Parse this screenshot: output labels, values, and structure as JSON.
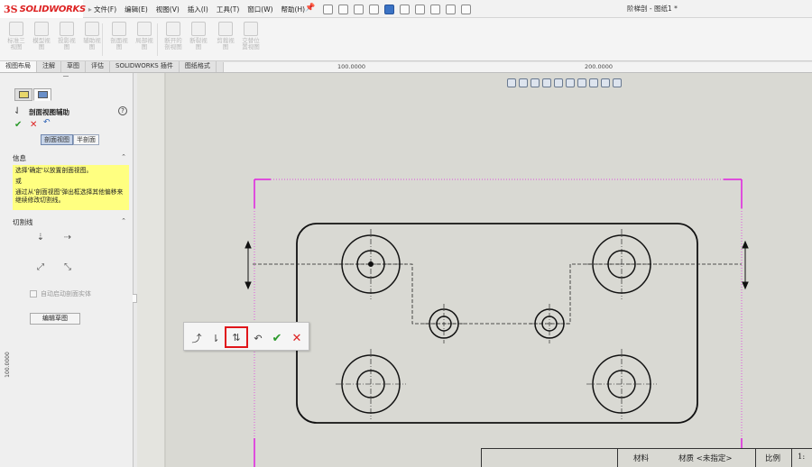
{
  "app": {
    "logo_mark": "3S",
    "logo_text": "SOLIDWORKS",
    "document_title": "阶梯剖 - 图纸1 *"
  },
  "menu": [
    "文件(F)",
    "编辑(E)",
    "视图(V)",
    "插入(I)",
    "工具(T)",
    "窗口(W)",
    "帮助(H)"
  ],
  "command_bar": [
    [
      "标准三",
      "视图"
    ],
    [
      "模型视",
      "图"
    ],
    [
      "投影视",
      "图"
    ],
    [
      "辅助视",
      "图"
    ],
    [
      "剖面视",
      "图"
    ],
    [
      "局部视",
      "图"
    ],
    [
      "断开的",
      "剖视图"
    ],
    [
      "断裂视",
      "图"
    ],
    [
      "剪裁视",
      "图"
    ],
    [
      "交替位",
      "置视图"
    ]
  ],
  "tabs": [
    "视图布局",
    "注解",
    "草图",
    "评估",
    "SOLIDWORKS 插件",
    "图纸格式"
  ],
  "active_tab": 0,
  "ruler": {
    "h_labels": [
      "100.0000",
      "200.0000"
    ],
    "v_label": "100.0000"
  },
  "property_manager": {
    "title": "剖面视图辅助",
    "help": "?",
    "ok_glyph": "✔",
    "cancel_glyph": "✕",
    "segments": [
      "剖面视图",
      "半剖面"
    ],
    "active_segment": 0,
    "info_header": "信息",
    "info_lines": [
      "选择'确定'以放置剖面视图。",
      "或",
      "通过从'剖面视图'弹出框选择其他偏移来继续修改切割线。"
    ],
    "cutline_header": "切割线",
    "auto_start": "自动启动剖面实体",
    "edit_sketch": "编辑草图"
  },
  "context_toolbar": {
    "buttons": [
      "arc-offset-icon",
      "single-offset-icon",
      "point-offset-icon",
      "notch-offset-icon",
      "undo-icon",
      "ok-icon",
      "cancel-icon"
    ],
    "selected": 2,
    "ok_glyph": "✔",
    "cancel_glyph": "✕"
  },
  "title_block": {
    "material_label": "材料",
    "material_value": "材质 <未指定>",
    "scale_label": "比例",
    "scale_value": "1:"
  },
  "colors": {
    "sheet_border": "#e020e0",
    "highlight": "#e0151a",
    "info_bg": "#ffff80"
  }
}
